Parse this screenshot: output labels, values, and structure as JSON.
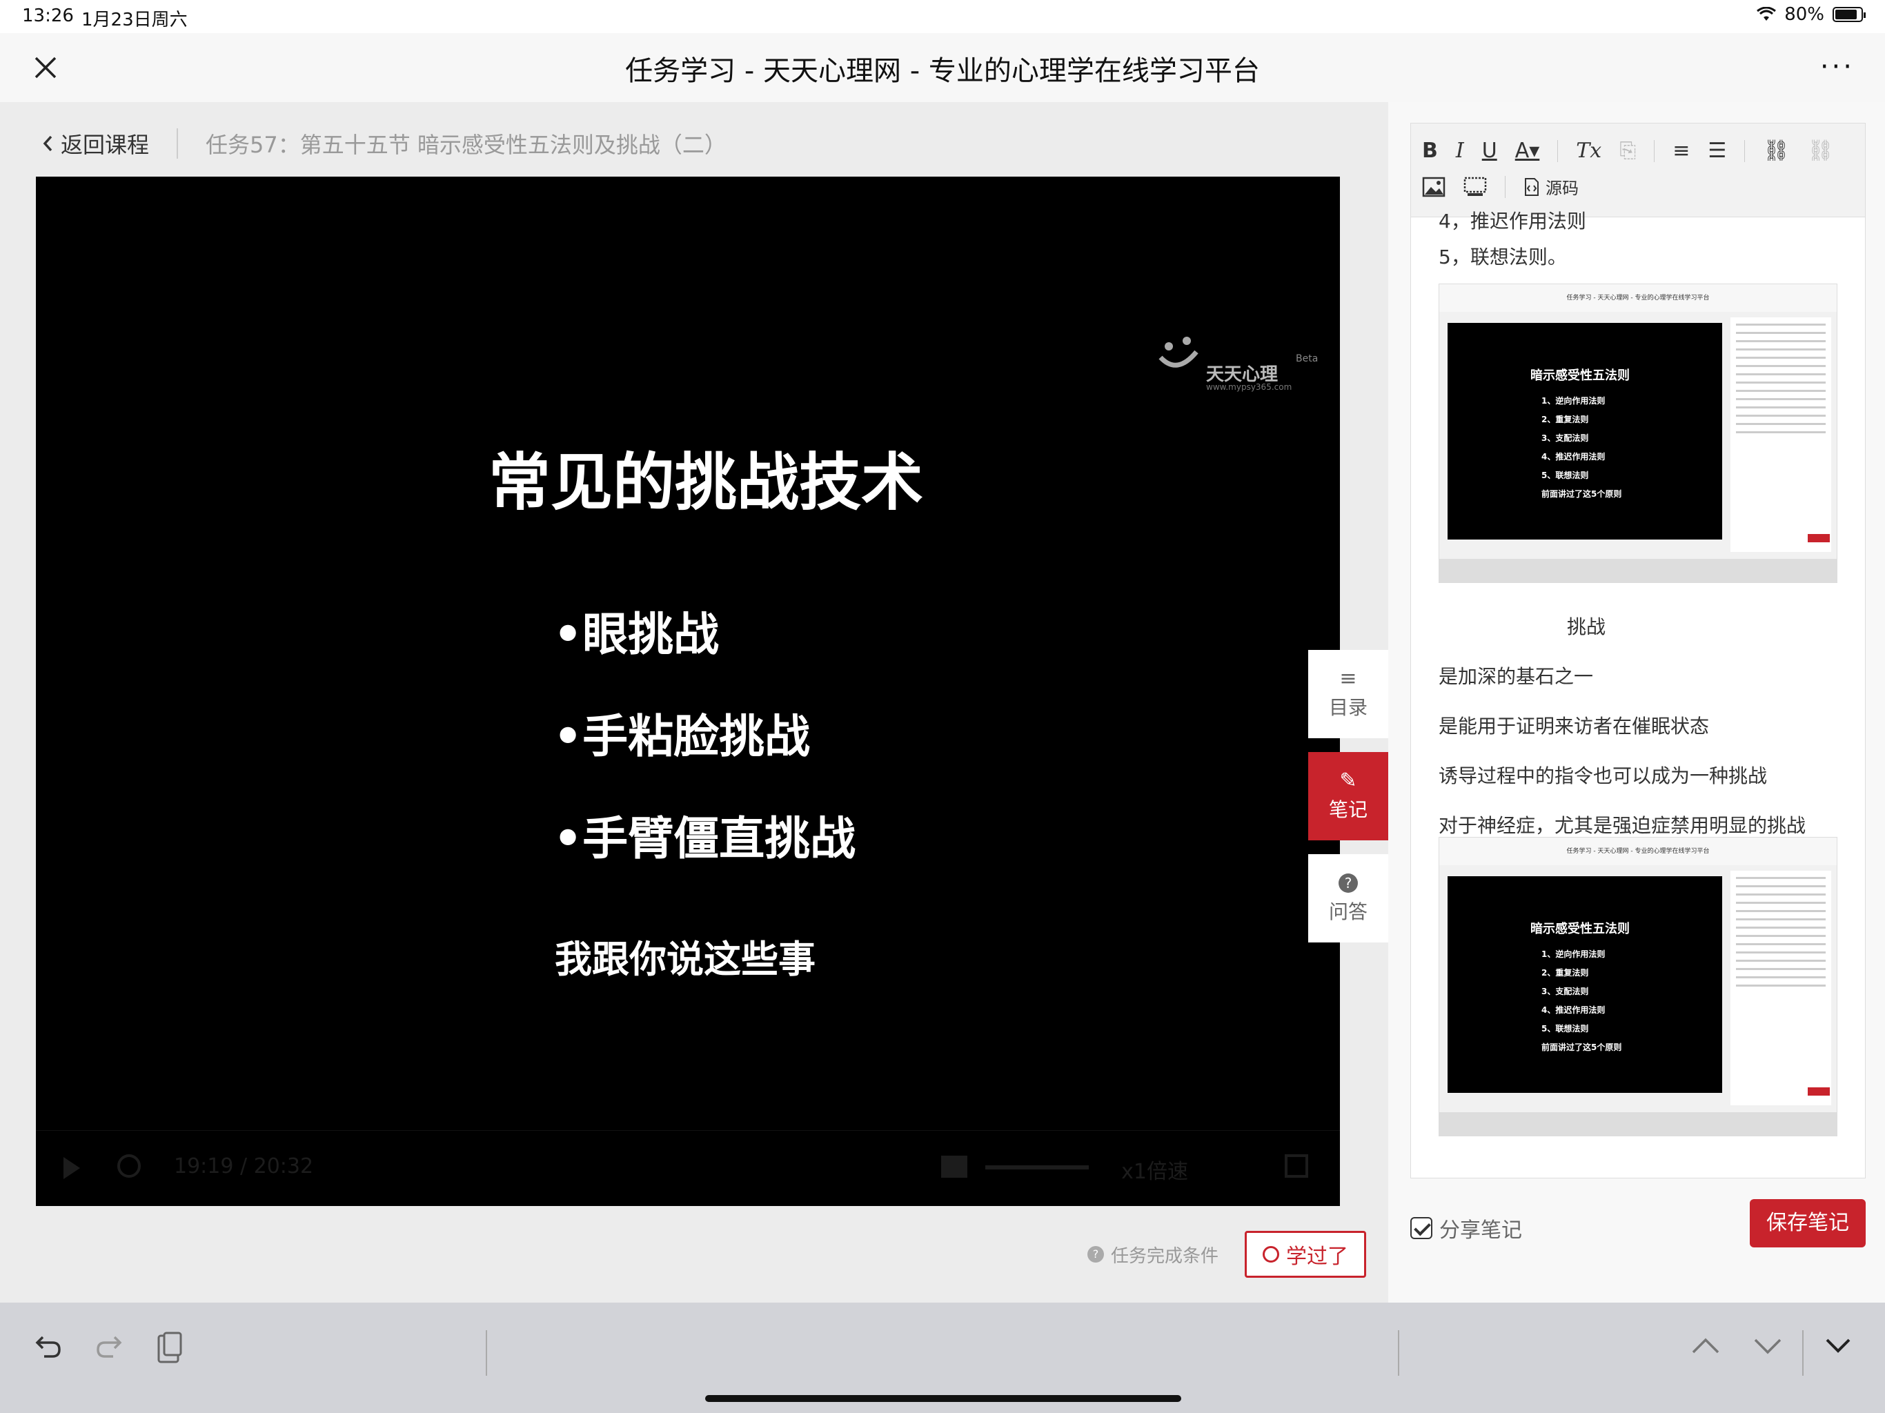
{
  "status": {
    "time": "13:26",
    "date": "1月23日周六",
    "battery": "80%"
  },
  "nav": {
    "title": "任务学习 - 天天心理网 - 专业的心理学在线学习平台"
  },
  "crumb": {
    "back": "返回课程",
    "task": "任务57：第五十五节 暗示感受性五法则及挑战（二）"
  },
  "video": {
    "logo": "天天心理",
    "logo_beta": "Beta",
    "logo_url": "www.mypsy365.com",
    "slide_title": "常见的挑战技术",
    "bullets": [
      "•眼挑战",
      "•手粘脸挑战",
      "•手臂僵直挑战"
    ],
    "slide_sub": "我跟你说这些事",
    "timecode": "19:19 / 20:32",
    "speed": "x1倍速"
  },
  "side_tabs": [
    {
      "label": "目录",
      "icon": "menu-icon"
    },
    {
      "label": "笔记",
      "icon": "pencil-icon"
    },
    {
      "label": "问答",
      "icon": "question-icon"
    }
  ],
  "task": {
    "condition": "任务完成条件",
    "learned": "学过了"
  },
  "editor": {
    "toolbar_row1": [
      "B",
      "I",
      "U",
      "A▾",
      "Tx",
      "⎘",
      "≡",
      "☰",
      "⛓",
      "⛓"
    ],
    "source_label": "源码",
    "lines": [
      "4，推迟作用法则",
      "5，联想法则。",
      "挑战",
      "是加深的基石之一",
      "是能用于证明来访者在催眠状态",
      "诱导过程中的指令也可以成为一种挑战",
      "对于神经症，尤其是强迫症禁用明显的挑战"
    ],
    "thumbnail": {
      "title": "任务学习 - 天天心理网 - 专业的心理学在线学习平台",
      "slide_title": "暗示感受性五法则",
      "items": [
        "1、逆向作用法则",
        "2、重复法则",
        "3、支配法则",
        "4、推迟作用法则",
        "5、联想法则",
        "前面讲过了这5个原则"
      ]
    }
  },
  "footer": {
    "share": "分享笔记",
    "save": "保存笔记"
  },
  "colors": {
    "accent": "#c8232c",
    "video_bg": "#000000",
    "pane_bg": "#ececec"
  }
}
